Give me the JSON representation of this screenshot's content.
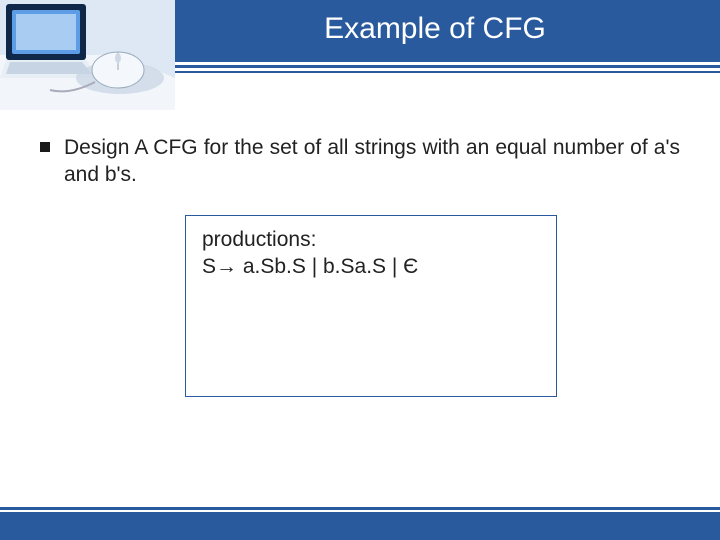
{
  "header": {
    "title": "Example of CFG"
  },
  "bullet": {
    "text": "Design A CFG for the set of all strings with an equal number of a's and b's."
  },
  "production_box": {
    "line1": "productions:",
    "line2": "S→ a.Sb.S | b.Sa.S | Є"
  },
  "colors": {
    "brand": "#2a5a9e"
  }
}
